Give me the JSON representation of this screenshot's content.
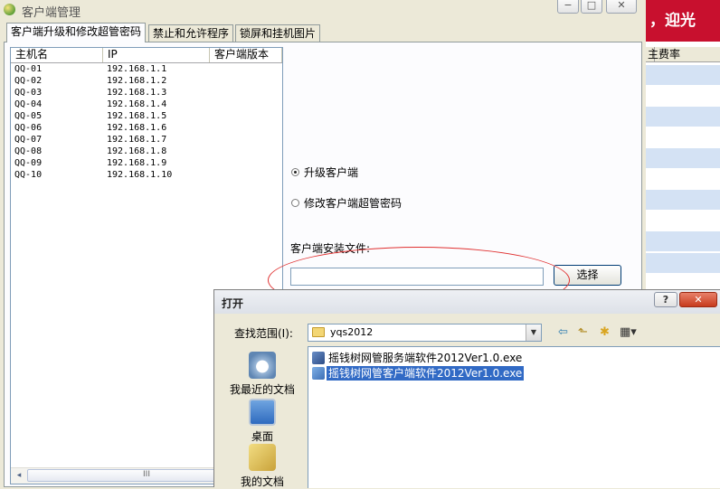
{
  "main_window": {
    "title": "客户端管理",
    "tabs": [
      {
        "label": "客户端升级和修改超管密码"
      },
      {
        "label": "禁止和允许程序"
      },
      {
        "label": "锁屏和挂机图片"
      }
    ],
    "host_table": {
      "columns": [
        "主机名",
        "IP",
        "客户端版本"
      ],
      "rows": [
        {
          "name": "QQ-01",
          "ip": "192.168.1.1"
        },
        {
          "name": "QQ-02",
          "ip": "192.168.1.2"
        },
        {
          "name": "QQ-03",
          "ip": "192.168.1.3"
        },
        {
          "name": "QQ-04",
          "ip": "192.168.1.4"
        },
        {
          "name": "QQ-05",
          "ip": "192.168.1.5"
        },
        {
          "name": "QQ-06",
          "ip": "192.168.1.6"
        },
        {
          "name": "QQ-07",
          "ip": "192.168.1.7"
        },
        {
          "name": "QQ-08",
          "ip": "192.168.1.8"
        },
        {
          "name": "QQ-09",
          "ip": "192.168.1.9"
        },
        {
          "name": "QQ-10",
          "ip": "192.168.1.10"
        }
      ],
      "scroll_thumb_grip": "III",
      "scroll_left": "◂",
      "scroll_right": "▸"
    },
    "options": {
      "upgrade_label": "升级客户端",
      "change_password_label": "修改客户端超管密码",
      "selected": "upgrade"
    },
    "install_file_label": "客户端安装文件:",
    "install_file_value": "",
    "choose_button": "选择",
    "title_buttons": {
      "minimize": "−",
      "maximize": "□",
      "close": "✕"
    }
  },
  "background_app": {
    "banner_text": "，迎光",
    "col1": "主",
    "col2": "费率",
    "banner_color": "#c8102e"
  },
  "open_dialog": {
    "title": "打开",
    "help_button": "?",
    "close_button": "✕",
    "lookin_label": "查找范围(I):",
    "lookin_value": "yqs2012",
    "lookin_arrow": "▼",
    "toolbar": {
      "back": "⇦",
      "up": "⬑",
      "new_folder": "✱",
      "views": "▦▾"
    },
    "places": [
      {
        "label": "我最近的文档",
        "icon": "recent-documents-icon"
      },
      {
        "label": "桌面",
        "icon": "desktop-icon"
      },
      {
        "label": "我的文档",
        "icon": "my-documents-icon"
      }
    ],
    "files": [
      {
        "name": "摇钱树网管服务端软件2012Ver1.0.exe",
        "selected": false
      },
      {
        "name": "摇钱树网管客户端软件2012Ver1.0.exe",
        "selected": true
      }
    ]
  }
}
